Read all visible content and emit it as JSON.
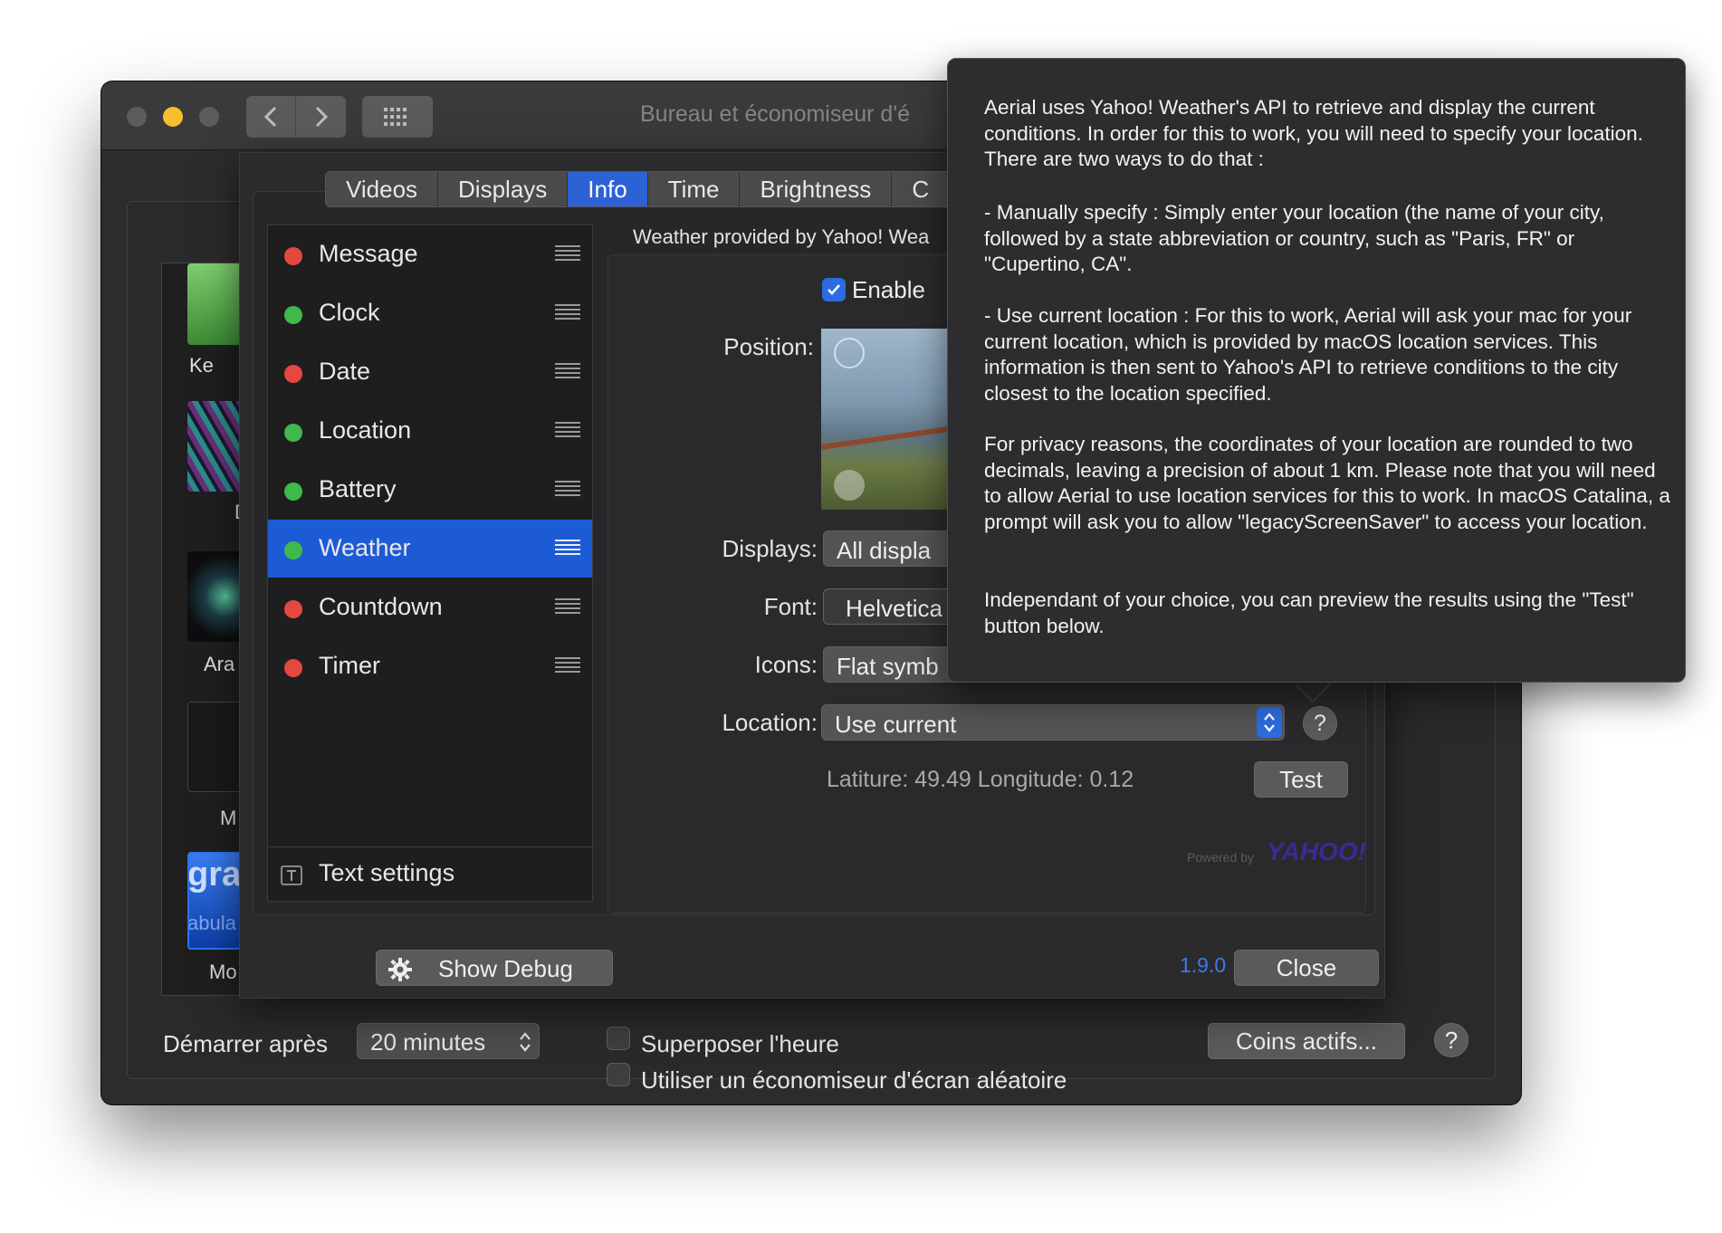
{
  "window": {
    "title": "Bureau et économiseur d'é",
    "bottom": {
      "start_after_label": "Démarrer après",
      "start_after_value": "20 minutes",
      "show_clock_label": "Superposer l'heure",
      "random_saver_label": "Utiliser un économiseur d'écran aléatoire",
      "hot_corners_label": "Coins actifs...",
      "help_label": "?"
    },
    "thumbnails": [
      "Ke",
      "D",
      "Ara",
      "M",
      "Mo"
    ],
    "thumbnail_overlay": {
      "line1": "grap",
      "line2": "abula"
    }
  },
  "sheet": {
    "tabs": [
      {
        "label": "Videos",
        "active": false
      },
      {
        "label": "Displays",
        "active": false
      },
      {
        "label": "Info",
        "active": true
      },
      {
        "label": "Time",
        "active": false
      },
      {
        "label": "Brightness",
        "active": false
      },
      {
        "label": "C",
        "active": false
      }
    ],
    "info_items": [
      {
        "label": "Message",
        "status": "red",
        "selected": false
      },
      {
        "label": "Clock",
        "status": "green",
        "selected": false
      },
      {
        "label": "Date",
        "status": "red",
        "selected": false
      },
      {
        "label": "Location",
        "status": "green",
        "selected": false
      },
      {
        "label": "Battery",
        "status": "green",
        "selected": false
      },
      {
        "label": "Weather",
        "status": "green",
        "selected": true
      },
      {
        "label": "Countdown",
        "status": "red",
        "selected": false
      },
      {
        "label": "Timer",
        "status": "red",
        "selected": false
      }
    ],
    "text_settings_label": "Text settings",
    "weather": {
      "header": "Weather provided by Yahoo! Wea",
      "enable_label": "Enable",
      "enable_checked": true,
      "position_label": "Position:",
      "displays_label": "Displays:",
      "displays_value": "All displa",
      "font_label": "Font:",
      "font_value": "Helvetica",
      "icons_label": "Icons:",
      "icons_value": "Flat symb",
      "location_label": "Location:",
      "location_value": "Use current",
      "coords_text": "Latiture: 49.49 Longitude: 0.12",
      "test_label": "Test",
      "powered_by": "Powered by",
      "yahoo_logo": "YAHOO!"
    },
    "show_debug_label": "Show Debug",
    "version": "1.9.0",
    "close_label": "Close"
  },
  "tooltip": {
    "p1": "Aerial uses Yahoo! Weather's API to retrieve and display the current conditions. In order for this to work, you will need to specify your location. There are two ways to do that :",
    "p2": "- Manually specify : Simply enter your location (the name of your city, followed by a state abbreviation or country, such as \"Paris, FR\" or \"Cupertino, CA\".",
    "p3": "- Use current location : For this to work, Aerial will ask your mac for your current location, which is provided by macOS location services. This information is then sent to Yahoo's API to retrieve conditions to the city closest to the location specified.",
    "p4": "For privacy reasons, the coordinates of your location are rounded to two decimals, leaving a precision of about 1 km. Please note that you will need to allow Aerial to use location services for this to work. In macOS Catalina, a prompt will ask you to allow \"legacyScreenSaver\" to access your location.",
    "p5": "Independant of your choice, you can preview the results using the \"Test\" button below."
  },
  "colors": {
    "accent": "#2c62d6",
    "status_red": "#e5483f",
    "status_green": "#3fb94a",
    "version_blue": "#3b7be8"
  }
}
